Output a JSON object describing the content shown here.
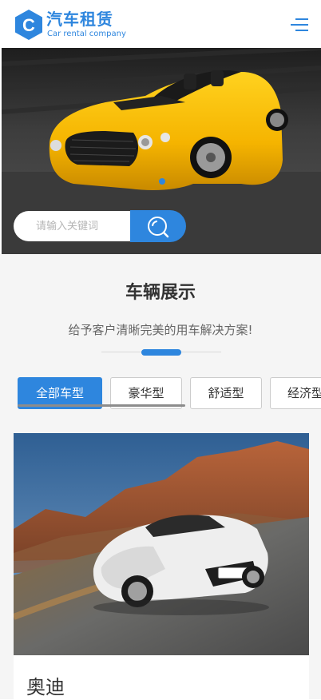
{
  "header": {
    "brand_cn": "汽车租赁",
    "brand_en": "Car rental company",
    "logo_letter": "C",
    "accent_color": "#2e86de",
    "menu_icon": "hamburger-menu-icon"
  },
  "banner": {
    "image": "yellow-roadster-photo",
    "active_slide": 1,
    "slide_count": 1
  },
  "search": {
    "placeholder": "请输入关键词",
    "button_icon": "search-icon"
  },
  "showcase": {
    "title": "车辆展示",
    "subtitle": "给予客户清晰完美的用车解决方案!",
    "tabs": [
      {
        "label": "全部车型",
        "active": true
      },
      {
        "label": "豪华型",
        "active": false
      },
      {
        "label": "舒适型",
        "active": false
      },
      {
        "label": "经济型",
        "active": false
      }
    ]
  },
  "cars": [
    {
      "name": "奥迪",
      "image": "white-audi-r8-photo"
    }
  ]
}
